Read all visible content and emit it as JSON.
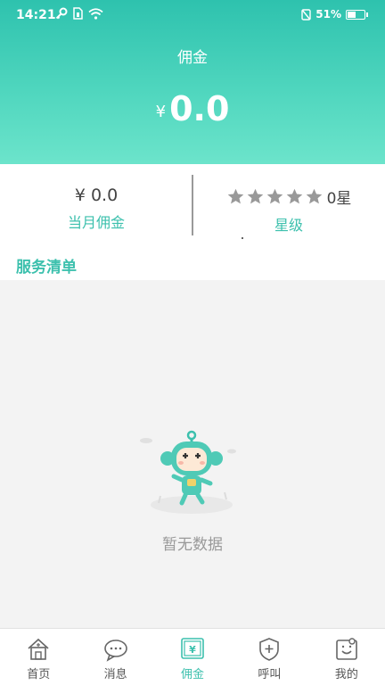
{
  "status_bar": {
    "time": "14:21",
    "battery_percent": "51%",
    "battery_level": 0.51
  },
  "header": {
    "title": "佣金",
    "currency": "¥",
    "amount": "0.0"
  },
  "stats": {
    "monthly": {
      "value": "¥ 0.0",
      "label": "当月佣金"
    },
    "rating": {
      "stars_total": 5,
      "stars_filled": 0,
      "value": "0星",
      "label": "星级"
    }
  },
  "section": {
    "title": "服务清单"
  },
  "empty_state": {
    "text": "暂无数据"
  },
  "tabs": [
    {
      "label": "首页",
      "icon": "home-icon",
      "active": false
    },
    {
      "label": "消息",
      "icon": "message-icon",
      "active": false
    },
    {
      "label": "佣金",
      "icon": "yen-icon",
      "active": true
    },
    {
      "label": "呼叫",
      "icon": "shield-plus-icon",
      "active": false
    },
    {
      "label": "我的",
      "icon": "profile-icon",
      "active": false
    }
  ],
  "colors": {
    "accent": "#3cc0ad",
    "header_top": "#2ec2ae",
    "header_bottom": "#6ce4cb",
    "star_gray": "#999999"
  }
}
